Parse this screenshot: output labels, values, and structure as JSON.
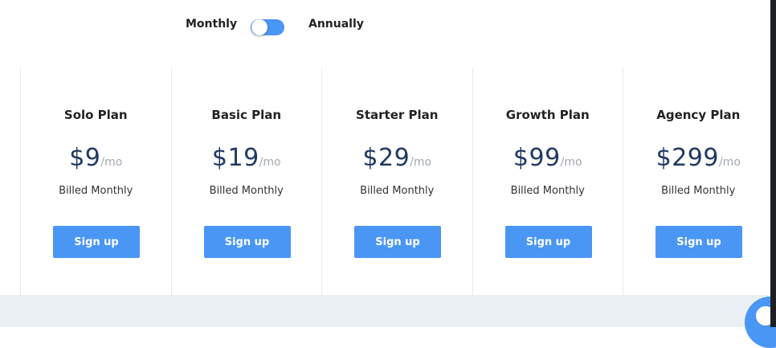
{
  "billing_toggle": {
    "monthly_label": "Monthly",
    "annually_label": "Annually",
    "selected": "Monthly",
    "accent_color": "#4a96f5"
  },
  "plans": [
    {
      "name": "Solo Plan",
      "currency": "$",
      "amount": "9",
      "unit": "/mo",
      "billing": "Billed Monthly",
      "cta": "Sign up"
    },
    {
      "name": "Basic Plan",
      "currency": "$",
      "amount": "19",
      "unit": "/mo",
      "billing": "Billed Monthly",
      "cta": "Sign up"
    },
    {
      "name": "Starter Plan",
      "currency": "$",
      "amount": "29",
      "unit": "/mo",
      "billing": "Billed Monthly",
      "cta": "Sign up"
    },
    {
      "name": "Growth Plan",
      "currency": "$",
      "amount": "99",
      "unit": "/mo",
      "billing": "Billed Monthly",
      "cta": "Sign up"
    },
    {
      "name": "Agency Plan",
      "currency": "$",
      "amount": "299",
      "unit": "/mo",
      "billing": "Billed Monthly",
      "cta": "Sign up"
    }
  ],
  "colors": {
    "price": "#1f3a63",
    "button": "#4a96f5",
    "footer": "#ebf0f4"
  },
  "chat_widget": {
    "icon": "chat-bubble-icon"
  }
}
